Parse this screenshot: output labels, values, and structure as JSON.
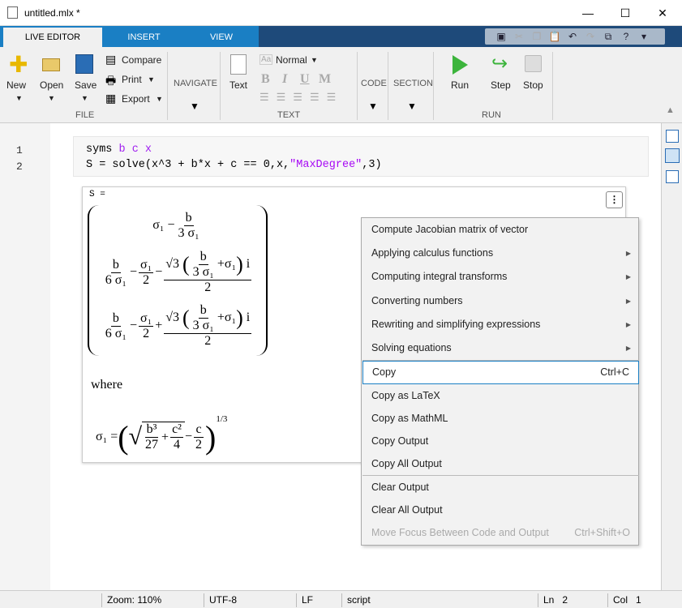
{
  "window": {
    "title": "untitled.mlx *",
    "minimize": "—",
    "maximize": "☐",
    "close": "✕"
  },
  "tabs": [
    {
      "label": "LIVE EDITOR"
    },
    {
      "label": "INSERT"
    },
    {
      "label": "VIEW"
    }
  ],
  "ribbon": {
    "file": {
      "group": "FILE",
      "new": "New",
      "open": "Open",
      "save": "Save",
      "compare": "Compare",
      "print": "Print",
      "export": "Export"
    },
    "navigate": {
      "group": "NAVIGATE"
    },
    "text": {
      "group": "TEXT",
      "text": "Text",
      "style": "Normal",
      "bold": "B",
      "italic": "I",
      "underline": "U",
      "mono": "M"
    },
    "code": {
      "group": "CODE"
    },
    "section": {
      "group": "SECTION"
    },
    "run": {
      "group": "RUN",
      "run": "Run",
      "step": "Step",
      "stop": "Stop"
    }
  },
  "editor": {
    "line_numbers": [
      "1",
      "2"
    ],
    "line1": {
      "kw": "syms ",
      "vars": "b c x"
    },
    "line2": {
      "pre": "S = solve(x^3 + b*x + c == 0,x,",
      "str": "\"MaxDegree\"",
      "post": ",3)"
    }
  },
  "output": {
    "header": "S =",
    "m": {
      "sigma": "σ₁",
      "minus": "−",
      "plus": "+",
      "b": "b",
      "three_sigma": "3 σ₁",
      "six_sigma": "6 σ₁",
      "two": "2",
      "sqrt3": "√3",
      "i": "i",
      "lp": "(",
      "rp": ")"
    },
    "where": "where",
    "def": {
      "lhs": "σ₁ =",
      "b3": "b³",
      "d27": "27",
      "c2": "c²",
      "d4": "4",
      "c": "c",
      "d2": "2",
      "exp": "1/3",
      "sqrt": "√"
    }
  },
  "context_menu": [
    {
      "label": "Compute Jacobian matrix of vector"
    },
    {
      "label": "Applying calculus functions",
      "submenu": true
    },
    {
      "label": "Computing integral transforms",
      "submenu": true
    },
    {
      "label": "Converting numbers",
      "submenu": true
    },
    {
      "label": "Rewriting and simplifying expressions",
      "submenu": true
    },
    {
      "label": "Solving equations",
      "submenu": true
    },
    {
      "label": "Copy",
      "shortcut": "Ctrl+C",
      "selected": true
    },
    {
      "label": "Copy as LaTeX"
    },
    {
      "label": "Copy as MathML"
    },
    {
      "label": "Copy Output"
    },
    {
      "label": "Copy All Output"
    },
    {
      "label": "Clear Output"
    },
    {
      "label": "Clear All Output"
    },
    {
      "label": "Move Focus Between Code and Output",
      "shortcut": "Ctrl+Shift+O",
      "disabled": true
    }
  ],
  "status": {
    "zoom": "Zoom: 110%",
    "encoding": "UTF-8",
    "eol": "LF",
    "mode": "script",
    "ln_label": "Ln",
    "ln": "2",
    "col_label": "Col",
    "col": "1"
  },
  "colors": {
    "tab_blue": "#1a7fc4",
    "tab_navy": "#1e4a7a",
    "variable": "#a020f0",
    "run_green": "#3cb43c"
  }
}
